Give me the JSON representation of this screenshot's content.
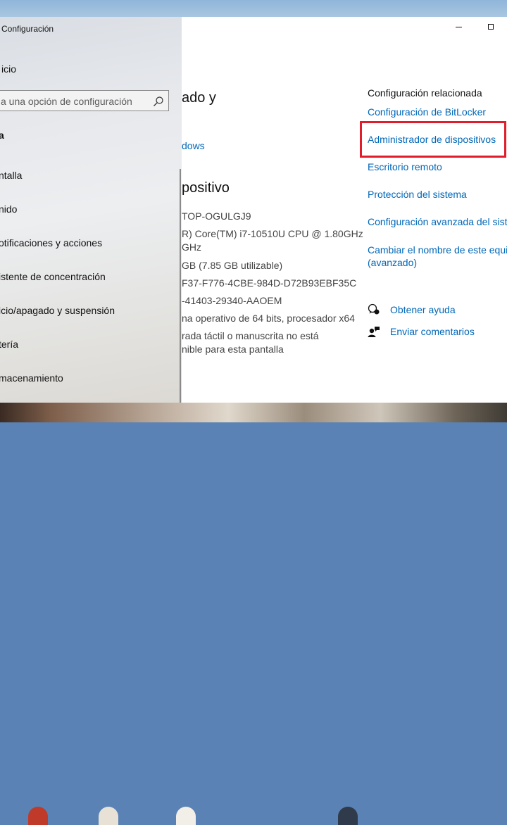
{
  "window": {
    "title": "Configuración",
    "minimize_icon": "minimize-icon",
    "maximize_icon": "maximize-icon"
  },
  "sidebar": {
    "home_label": "icio",
    "search_placeholder": "a una opción de configuración",
    "search_icon": "search-icon",
    "section_label": "a",
    "items": [
      {
        "label": "ntalla"
      },
      {
        "label": "nido"
      },
      {
        "label": "otificaciones y acciones"
      },
      {
        "label": "istente de concentración"
      },
      {
        "label": "icio/apagado y suspensión"
      },
      {
        "label": "tería"
      },
      {
        "label": "macenamiento"
      }
    ]
  },
  "main": {
    "heading": "ado y",
    "windows_link": "dows",
    "device_heading": "positivo",
    "specs": [
      "TOP-OGULGJ9",
      "R) Core(TM) i7-10510U CPU @ 1.80GHz",
      "GHz",
      "GB (7.85 GB utilizable)",
      "F37-F776-4CBE-984D-D72B93EBF35C",
      "-41403-29340-AAOEM",
      "na operativo de 64 bits, procesador x64",
      "rada táctil o manuscrita no está",
      "nible para esta pantalla"
    ]
  },
  "related": {
    "title": "Configuración relacionada",
    "links": [
      "Configuración de BitLocker",
      "Administrador de dispositivos",
      "Escritorio remoto",
      "Protección del sistema",
      "Configuración avanzada del siste",
      "Cambiar el nombre de este equi",
      "(avanzado)"
    ],
    "highlight_color": "#e21d2b",
    "help_label": "Obtener ayuda",
    "feedback_label": "Enviar comentarios"
  },
  "colors": {
    "link": "#0067b8",
    "text": "#111111"
  }
}
